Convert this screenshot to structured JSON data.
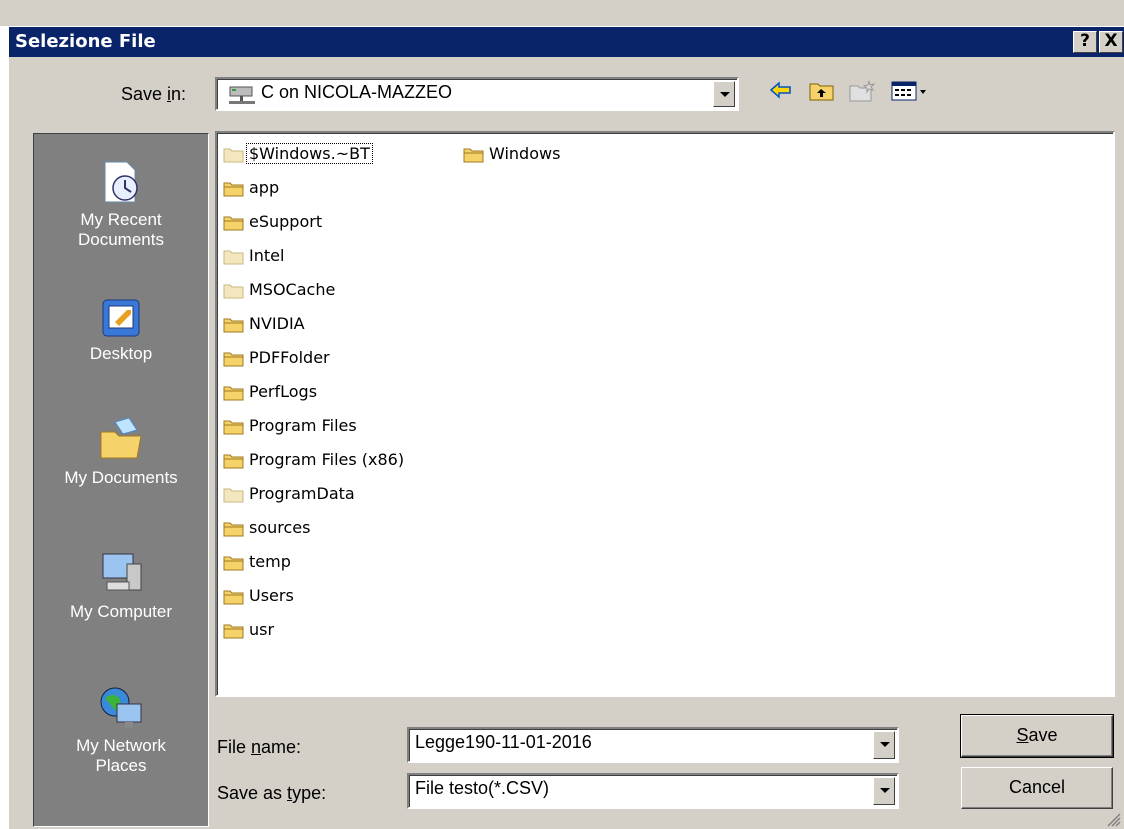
{
  "dialog": {
    "title": "Selezione File"
  },
  "titlebar_buttons": {
    "help": "?",
    "close": "X"
  },
  "save_in": {
    "label_pre": "Save ",
    "label_key": "i",
    "label_post": "n:",
    "value": "C on NICOLA-MAZZEO"
  },
  "places": [
    {
      "line1": "My Recent",
      "line2": "Documents",
      "icon": "recent-documents-icon"
    },
    {
      "line1": "Desktop",
      "line2": "",
      "icon": "desktop-icon"
    },
    {
      "line1": "My Documents",
      "line2": "",
      "icon": "my-documents-icon"
    },
    {
      "line1": "My Computer",
      "line2": "",
      "icon": "my-computer-icon"
    },
    {
      "line1": "My Network",
      "line2": "Places",
      "icon": "network-places-icon"
    }
  ],
  "files": [
    {
      "name": "$Windows.~BT",
      "hidden": true
    },
    {
      "name": "app",
      "hidden": false
    },
    {
      "name": "eSupport",
      "hidden": false
    },
    {
      "name": "Intel",
      "hidden": true
    },
    {
      "name": "MSOCache",
      "hidden": true
    },
    {
      "name": "NVIDIA",
      "hidden": false
    },
    {
      "name": "PDFFolder",
      "hidden": false
    },
    {
      "name": "PerfLogs",
      "hidden": false
    },
    {
      "name": "Program Files",
      "hidden": false
    },
    {
      "name": "Program Files (x86)",
      "hidden": false
    },
    {
      "name": "ProgramData",
      "hidden": true
    },
    {
      "name": "sources",
      "hidden": false
    },
    {
      "name": "temp",
      "hidden": false
    },
    {
      "name": "Users",
      "hidden": false
    },
    {
      "name": "usr",
      "hidden": false
    },
    {
      "name": "Windows",
      "hidden": false
    }
  ],
  "file_name": {
    "label_pre": "File ",
    "label_key": "n",
    "label_post": "ame:",
    "value": "Legge190-11-01-2016"
  },
  "save_as_type": {
    "label_pre": "Save as ",
    "label_key": "t",
    "label_post": "ype:",
    "value": "File testo(*.CSV)"
  },
  "buttons": {
    "save_key": "S",
    "save_rest": "ave",
    "cancel": "Cancel"
  },
  "colors": {
    "titlebar": "#0a246a",
    "face": "#d4d0c8",
    "places_bg": "#808080",
    "folder": "#f5d36a"
  }
}
